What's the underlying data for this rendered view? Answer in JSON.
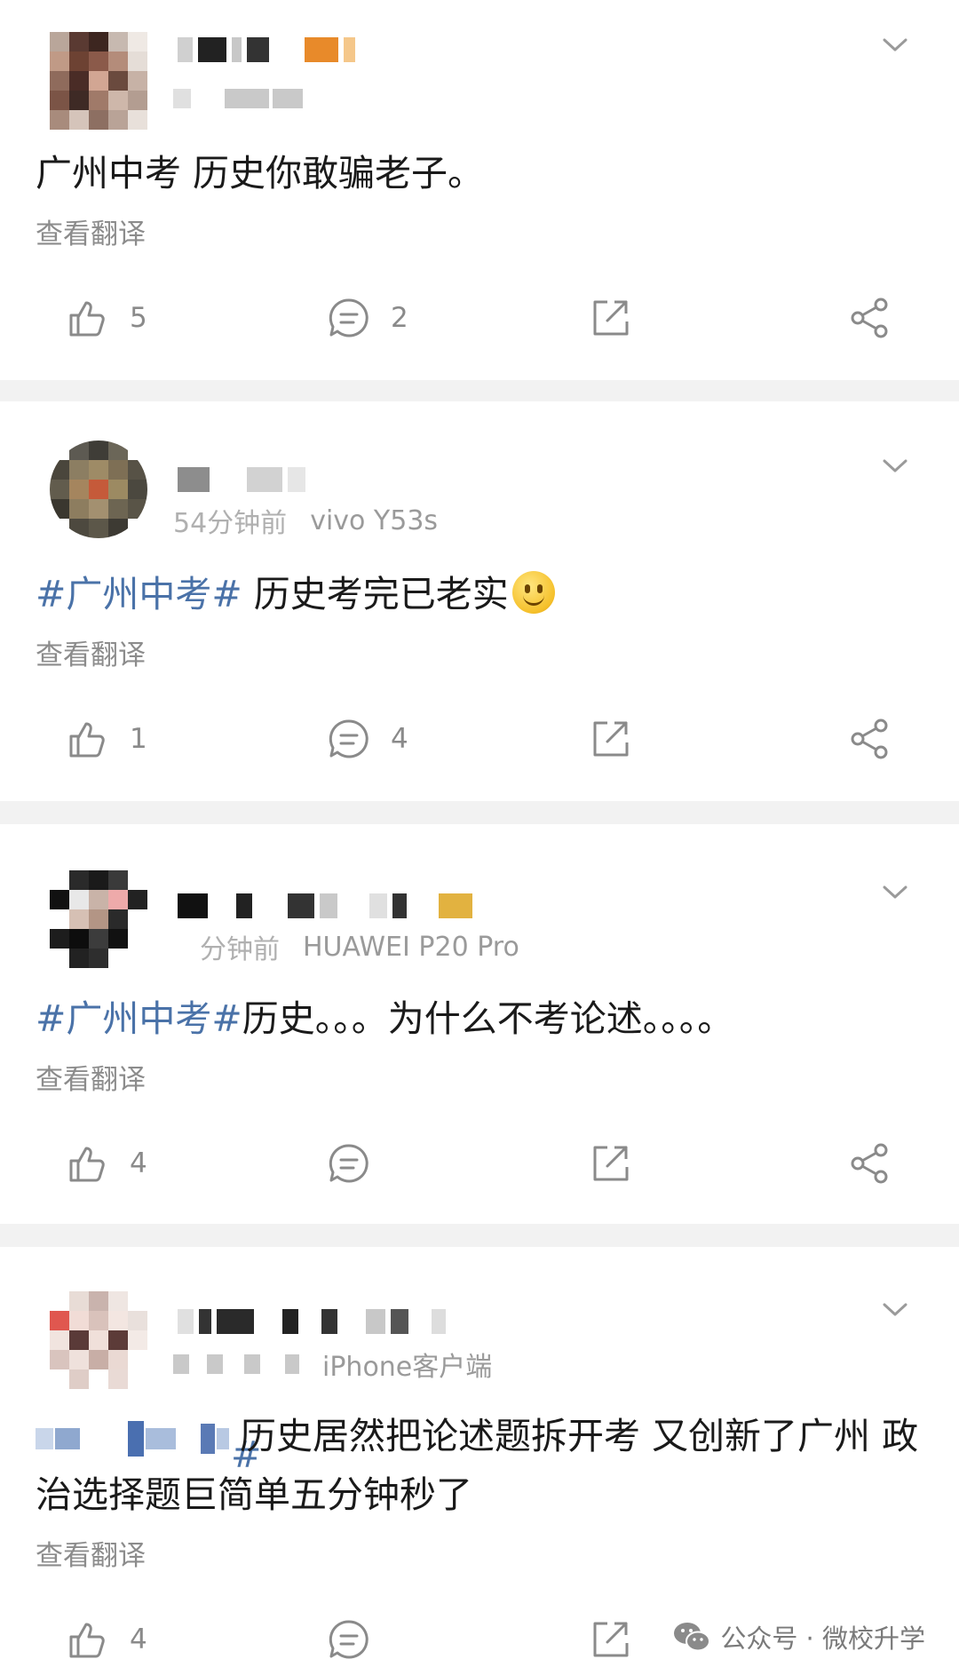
{
  "posts": [
    {
      "meta_text": "",
      "content_plain": "广州中考 历史你敢骗老子。",
      "translate_label": "查看翻译",
      "likes": "5",
      "comments": "2"
    },
    {
      "meta_text": "vivo Y53s",
      "time_text": "54分钟前",
      "content_tag": "#广州中考#",
      "content_plain": " 历史考完已老实",
      "emoji": "smiley-emoji",
      "translate_label": "查看翻译",
      "likes": "1",
      "comments": "4"
    },
    {
      "meta_text": "HUAWEI P20 Pro",
      "time_text": "分钟前",
      "content_tag": "#广州中考#",
      "content_plain": "历史。。。为什么不考论述。。。。",
      "translate_label": "查看翻译",
      "likes": "4",
      "comments": ""
    },
    {
      "meta_text": "iPhone客户端",
      "content_plain": "历史居然把论述题拆开考 又创新了广州 政治选择题巨简单五分钟秒了",
      "translate_label": "查看翻译",
      "likes": "4",
      "comments": ""
    }
  ],
  "watermark": {
    "text": "公众号 · 微校升学",
    "icon": "wechat-icon"
  },
  "icons": {
    "like": "thumbs-up-icon",
    "comment": "comment-icon",
    "repost": "repost-icon",
    "share": "share-icon",
    "menu": "chevron-down-icon"
  },
  "colors": {
    "hashtag": "#4a72a8",
    "muted": "#8c8c8c",
    "divider": "#f2f2f2"
  }
}
